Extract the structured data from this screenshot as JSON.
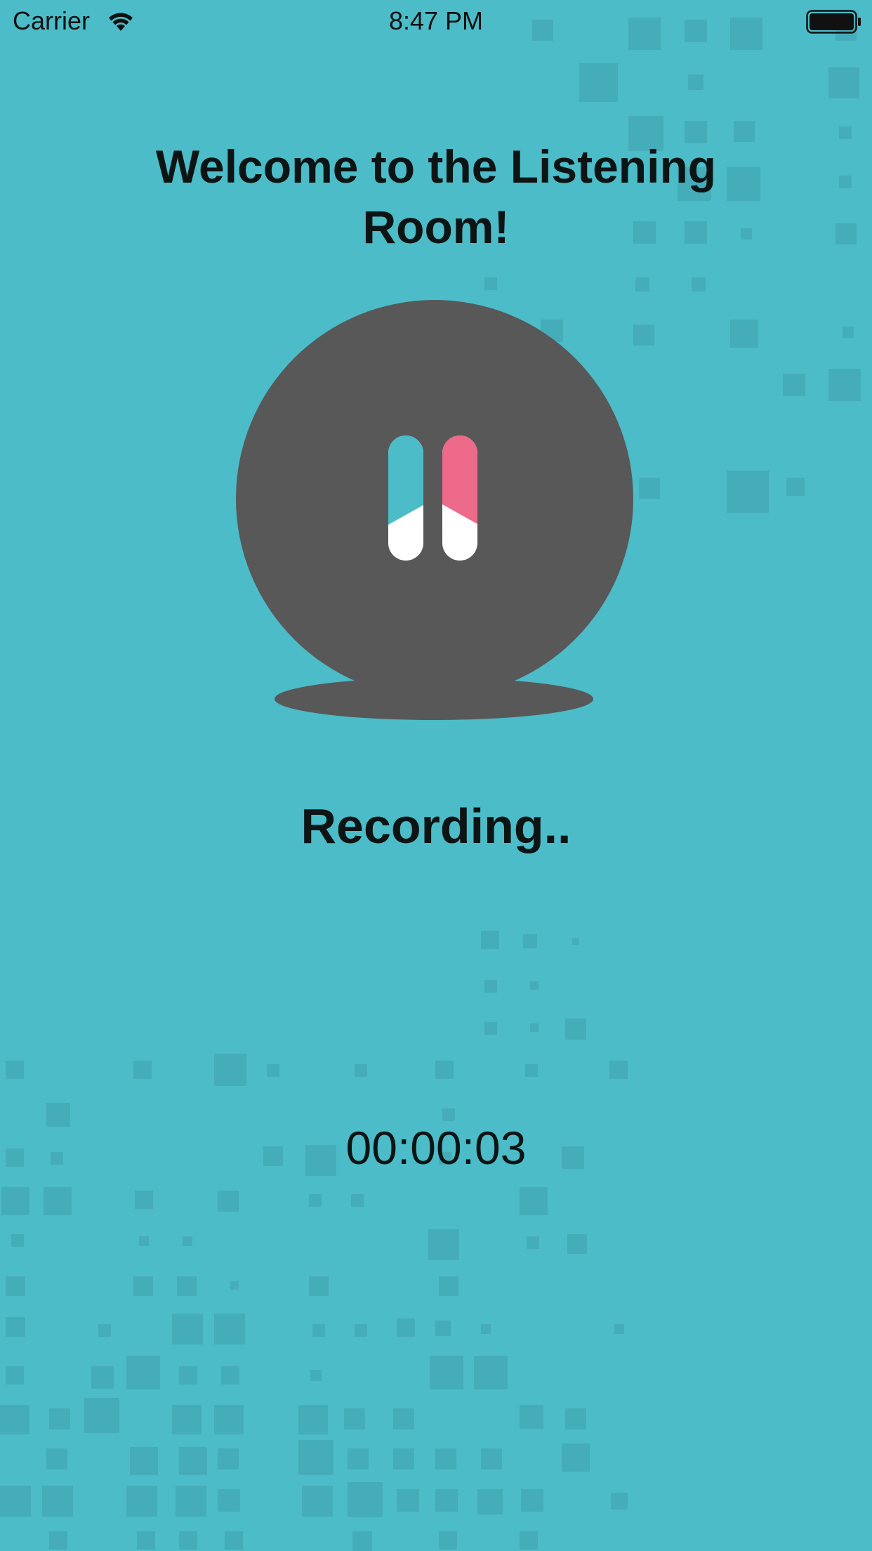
{
  "status_bar": {
    "carrier": "Carrier",
    "time": "8:47 PM",
    "wifi_icon": "wifi-icon",
    "battery_icon": "battery-full-icon"
  },
  "header": {
    "title": "Welcome to the Listening Room!"
  },
  "recorder": {
    "button_icon": "pause-icon",
    "status": "Recording..",
    "elapsed": "00:00:03"
  },
  "colors": {
    "background": "#4bbcc8",
    "pattern": "#44aab6",
    "button_body": "#585858",
    "pause_left_bar": "#4bbcc8",
    "pause_right_bar": "#ee6a8a",
    "pause_bar_base": "#ffffff",
    "text": "#0d1414"
  }
}
